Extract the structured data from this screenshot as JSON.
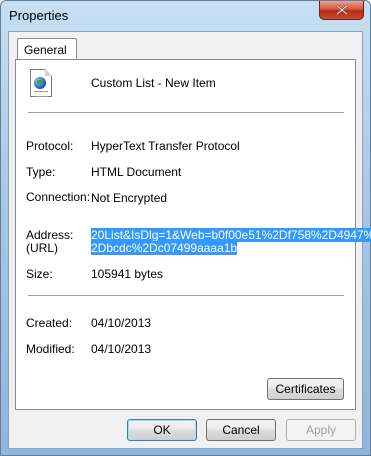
{
  "window": {
    "title": "Properties"
  },
  "tabs": [
    {
      "label": "General"
    }
  ],
  "item": {
    "name": "Custom List - New Item"
  },
  "properties": {
    "protocol_label": "Protocol:",
    "protocol_value": "HyperText Transfer Protocol",
    "type_label": "Type:",
    "type_value": "HTML Document",
    "connection_label": "Connection:",
    "connection_value": "Not Encrypted",
    "address_label": "Address:",
    "address_label_2": "(URL)",
    "address_line1": "20List&IsDlg=1&Web=b0f00e51%2Df758%2D4947%",
    "address_line2": "2Dbcdc%2Dc07499aaaa1b",
    "size_label": "Size:",
    "size_value": "105941 bytes",
    "created_label": "Created:",
    "created_value": "04/10/2013",
    "modified_label": "Modified:",
    "modified_value": "04/10/2013"
  },
  "buttons": {
    "certificates": "Certificates",
    "ok": "OK",
    "cancel": "Cancel",
    "apply": "Apply"
  },
  "icons": {
    "close": "close-icon",
    "file": "html-document-icon"
  },
  "colors": {
    "selection": "#3399ff",
    "close_button": "#c74a30"
  }
}
